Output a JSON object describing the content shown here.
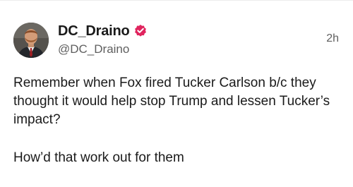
{
  "post": {
    "display_name": "DC_Draino",
    "handle": "@DC_Draino",
    "timestamp": "2h",
    "verified": true,
    "accent_color": "#e0245e",
    "paragraphs": [
      "Remember when Fox fired Tucker Carlson b/c they thought it would help stop Trump and lessen Tucker’s impact?",
      "How’d that work out for them"
    ]
  }
}
